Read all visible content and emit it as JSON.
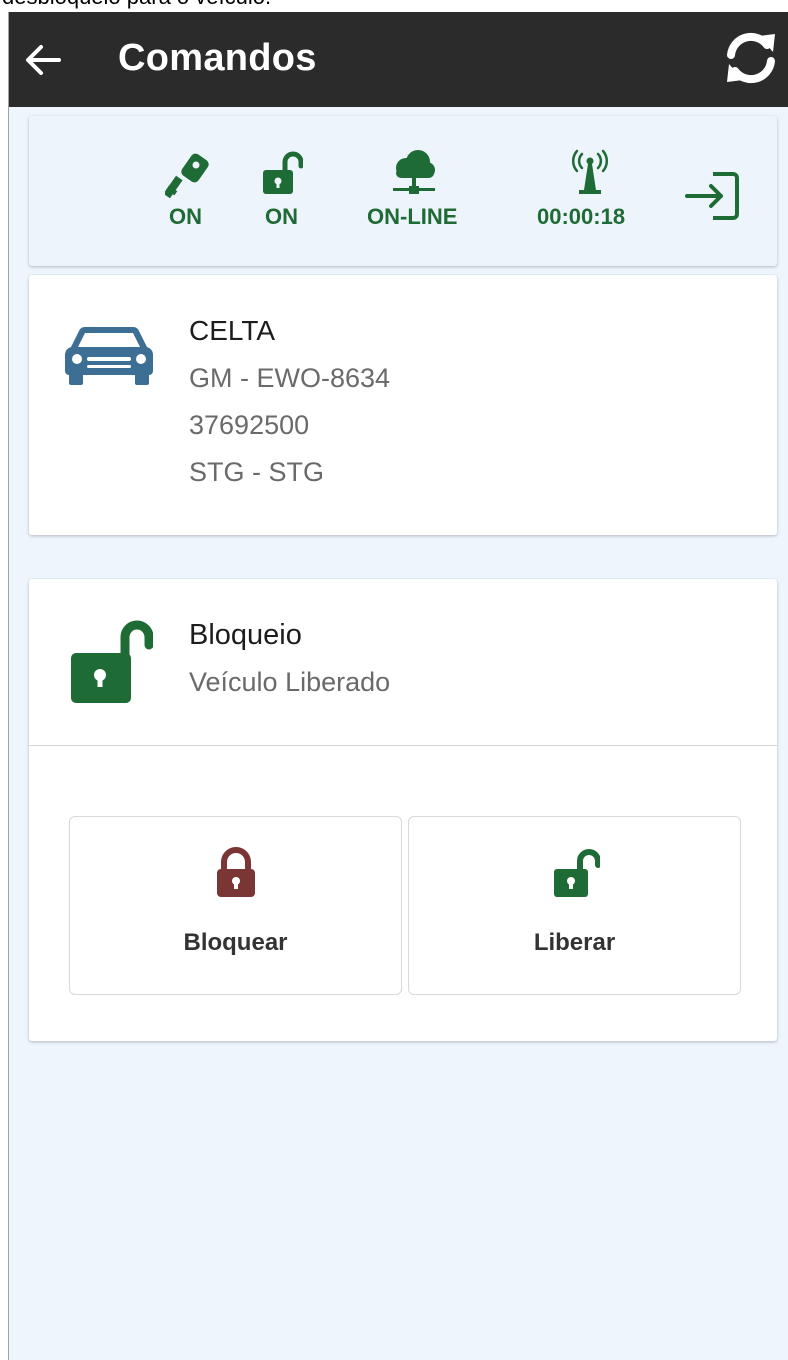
{
  "caption": "desbloqueio para o veículo.",
  "appbar": {
    "title": "Comandos",
    "back_icon": "arrow-left-icon",
    "refresh_icon": "refresh-icon",
    "background": "#2b2b2b"
  },
  "status": {
    "accent": "#1f6b35",
    "items": [
      {
        "icon": "key-icon",
        "label": "ON"
      },
      {
        "icon": "lock-open-icon",
        "label": "ON"
      },
      {
        "icon": "cloud-network-icon",
        "label": "ON-LINE"
      },
      {
        "icon": "antenna-signal-icon",
        "label": "00:00:18"
      }
    ],
    "exit_icon": "sign-in-icon"
  },
  "vehicle": {
    "icon": "car-icon",
    "icon_color": "#3d6f94",
    "name": "CELTA",
    "lines": [
      "GM - EWO-8634",
      "37692500",
      "STG - STG"
    ]
  },
  "block": {
    "icon": "lock-open-icon",
    "title": "Bloqueio",
    "status": "Veículo Liberado",
    "buttons": [
      {
        "label": "Bloquear",
        "icon": "lock-closed-icon",
        "color": "#7a3535"
      },
      {
        "label": "Liberar",
        "icon": "lock-open-icon",
        "color": "#1f6b35"
      }
    ]
  }
}
